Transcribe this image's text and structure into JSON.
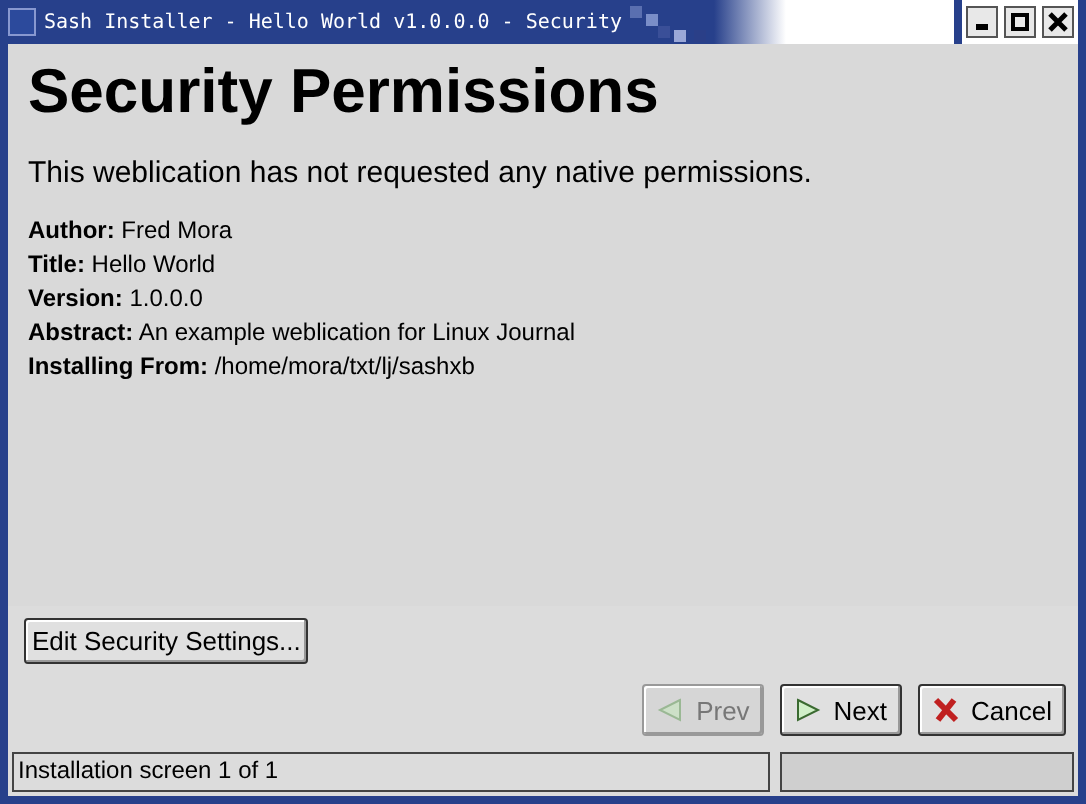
{
  "window": {
    "title": "Sash Installer - Hello World v1.0.0.0 - Security"
  },
  "heading": "Security Permissions",
  "message": "This weblication has not requested any native permissions.",
  "details": [
    {
      "label": "Author:",
      "value": "Fred Mora"
    },
    {
      "label": "Title:",
      "value": "Hello World"
    },
    {
      "label": "Version:",
      "value": "1.0.0.0"
    },
    {
      "label": "Abstract:",
      "value": "An example weblication for Linux Journal"
    },
    {
      "label": "Installing From:",
      "value": "/home/mora/txt/lj/sashxb"
    }
  ],
  "edit_button": "Edit Security Settings...",
  "nav_buttons": [
    {
      "kind": "prev",
      "label": "Prev",
      "disabled": true
    },
    {
      "kind": "next",
      "label": "Next",
      "disabled": false
    },
    {
      "kind": "cancel",
      "label": "Cancel",
      "disabled": false
    }
  ],
  "status_bar": "Installation screen 1 of 1"
}
